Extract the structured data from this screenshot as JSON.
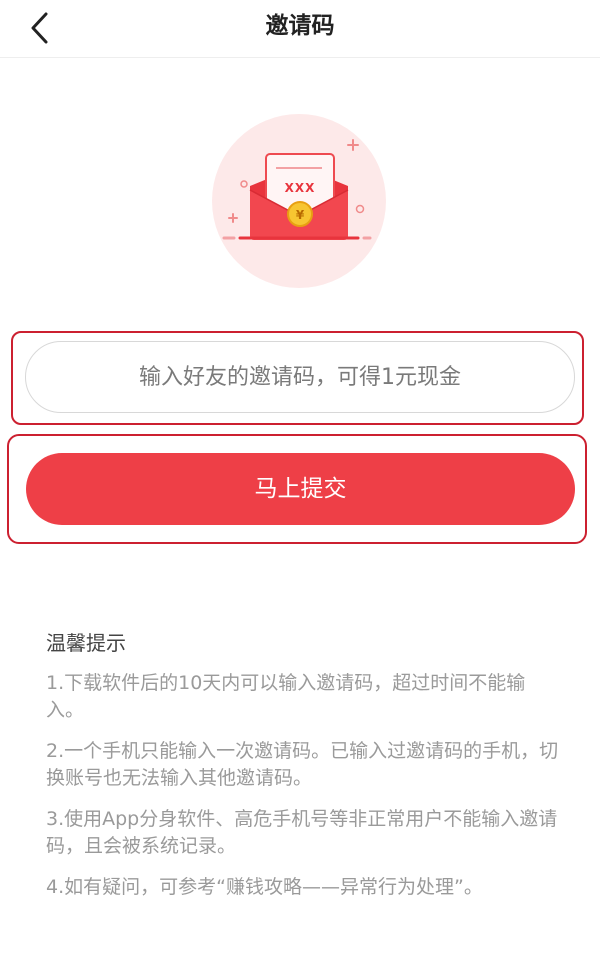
{
  "header": {
    "title": "邀请码"
  },
  "form": {
    "input_placeholder": "输入好友的邀请码，可得1元现金",
    "input_value": "",
    "submit_label": "马上提交"
  },
  "illustration": {
    "envelope_text": "XXX",
    "coin_symbol": "¥"
  },
  "tips": {
    "title": "温馨提示",
    "items": [
      "1.下载软件后的10天内可以输入邀请码，超过时间不能输入。",
      "2.一个手机只能输入一次邀请码。已输入过邀请码的手机，切换账号也无法输入其他邀请码。",
      "3.使用App分身软件、高危手机号等非正常用户不能输入邀请码，且会被系统记录。",
      "4.如有疑问，可参考“赚钱攻略——异常行为处理”。"
    ]
  },
  "colors": {
    "accent": "#ee3f47",
    "highlight_border": "#cc2030",
    "illustration_bg": "#fde9e9"
  },
  "icons": {
    "back": "chevron-left-icon",
    "illustration": "red-envelope-icon"
  }
}
